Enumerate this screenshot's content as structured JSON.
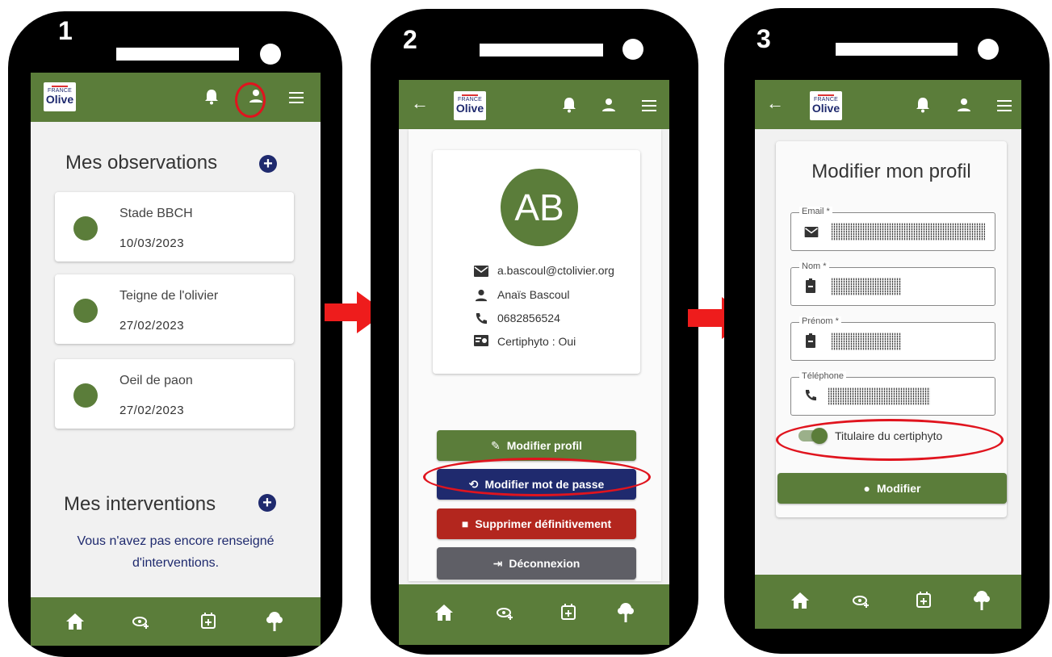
{
  "steps": [
    "1",
    "2",
    "3"
  ],
  "logo": {
    "top": "FRANCE",
    "brand": "Olive"
  },
  "screen1": {
    "observations_title": "Mes observations",
    "observations": [
      {
        "title": "Stade BBCH",
        "date": "10/03/2023"
      },
      {
        "title": "Teigne de l'olivier",
        "date": "27/02/2023"
      },
      {
        "title": "Oeil de paon",
        "date": "27/02/2023"
      }
    ],
    "interventions_title": "Mes interventions",
    "empty_line1": "Vous n'avez pas encore renseigné",
    "empty_line2": "d'interventions."
  },
  "screen2": {
    "initials": "AB",
    "email": "a.bascoul@ctolivier.org",
    "name": "Anaïs Bascoul",
    "phone": "0682856524",
    "certiphyto": "Certiphyto : Oui",
    "buttons": {
      "edit_profile": "Modifier profil",
      "change_password": "Modifier mot de passe",
      "delete": "Supprimer définitivement",
      "logout": "Déconnexion"
    }
  },
  "screen3": {
    "title": "Modifier mon profil",
    "fields": {
      "email_label": "Email *",
      "nom_label": "Nom *",
      "prenom_label": "Prénom *",
      "tel_label": "Téléphone"
    },
    "toggle_label": "Titulaire du certiphyto",
    "submit": "Modifier"
  },
  "colors": {
    "green": "#5b7d3a",
    "navy": "#1f2a6e",
    "red_button": "#b3261e",
    "grey_button": "#5f5f66",
    "highlight": "#e0141e"
  }
}
